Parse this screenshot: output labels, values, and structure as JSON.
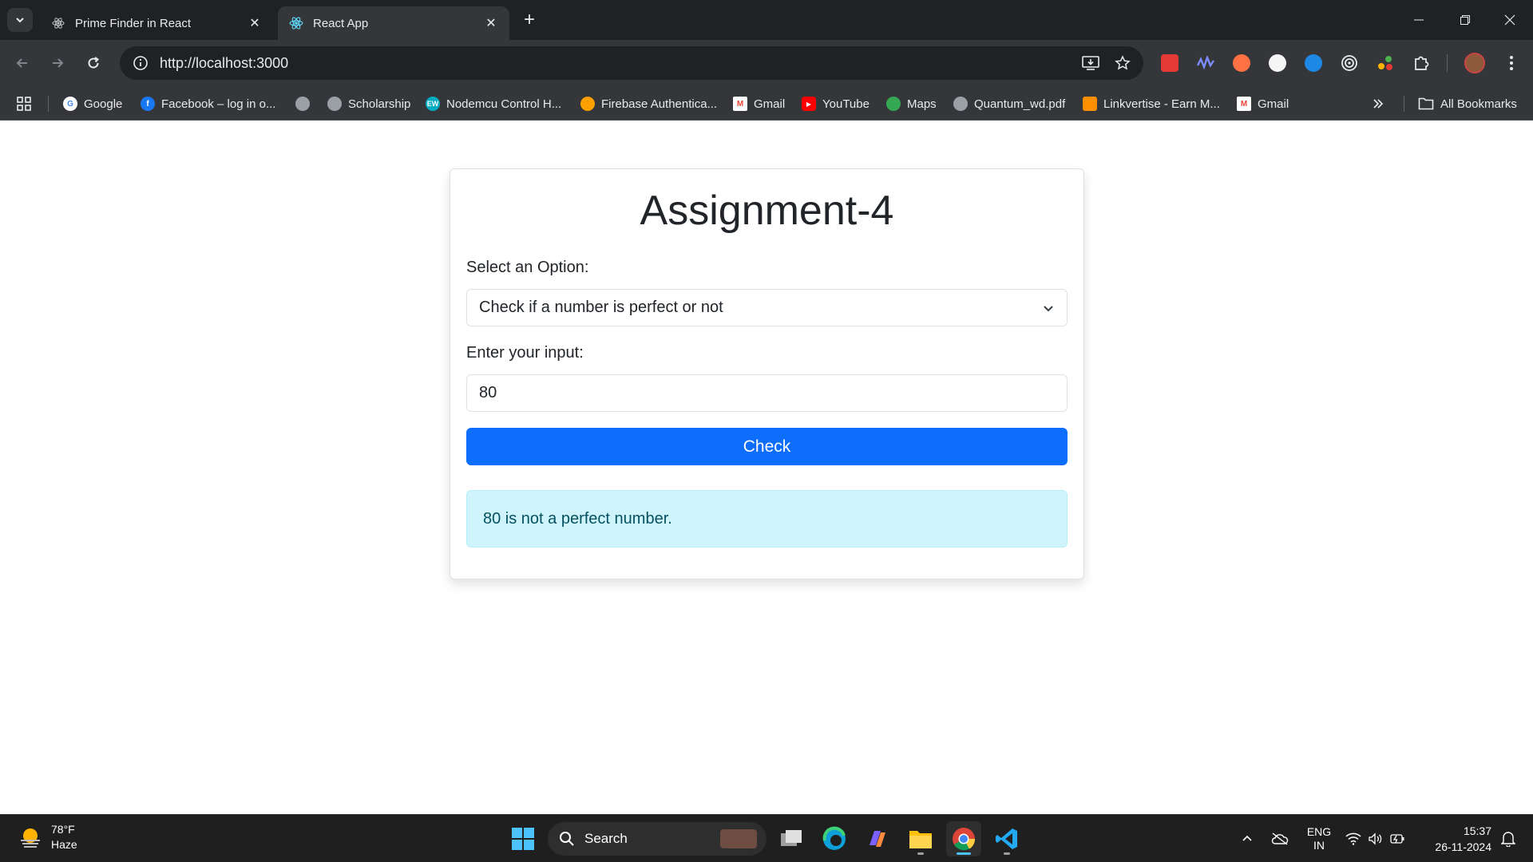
{
  "browser": {
    "tabs": [
      {
        "title": "Prime Finder in React",
        "active": false
      },
      {
        "title": "React App",
        "active": true
      }
    ],
    "url": "http://localhost:3000",
    "bookmarks": [
      {
        "label": "Google"
      },
      {
        "label": "Facebook – log in o..."
      },
      {
        "label": ""
      },
      {
        "label": "Scholarship"
      },
      {
        "label": "Nodemcu Control H..."
      },
      {
        "label": "Firebase Authentica..."
      },
      {
        "label": "Gmail"
      },
      {
        "label": "YouTube"
      },
      {
        "label": "Maps"
      },
      {
        "label": "Quantum_wd.pdf"
      },
      {
        "label": "Linkvertise - Earn M..."
      },
      {
        "label": "Gmail"
      }
    ],
    "all_bookmarks_label": "All Bookmarks",
    "bookmark_badge_ew": "EW"
  },
  "app": {
    "title": "Assignment-4",
    "select_label": "Select an Option:",
    "selected_option": "Check if a number is perfect or not",
    "input_label": "Enter your input:",
    "input_value": "80",
    "check_button": "Check",
    "result": "80 is not a perfect number."
  },
  "taskbar": {
    "weather_temp": "78°F",
    "weather_desc": "Haze",
    "search_label": "Search",
    "lang_top": "ENG",
    "lang_bottom": "IN",
    "time": "15:37",
    "date": "26-11-2024"
  },
  "colors": {
    "primary_button": "#0d6efd",
    "alert_bg": "#cff4fc",
    "alert_text": "#055160",
    "chrome_dark": "#202124",
    "chrome_toolbar": "#35363a"
  }
}
